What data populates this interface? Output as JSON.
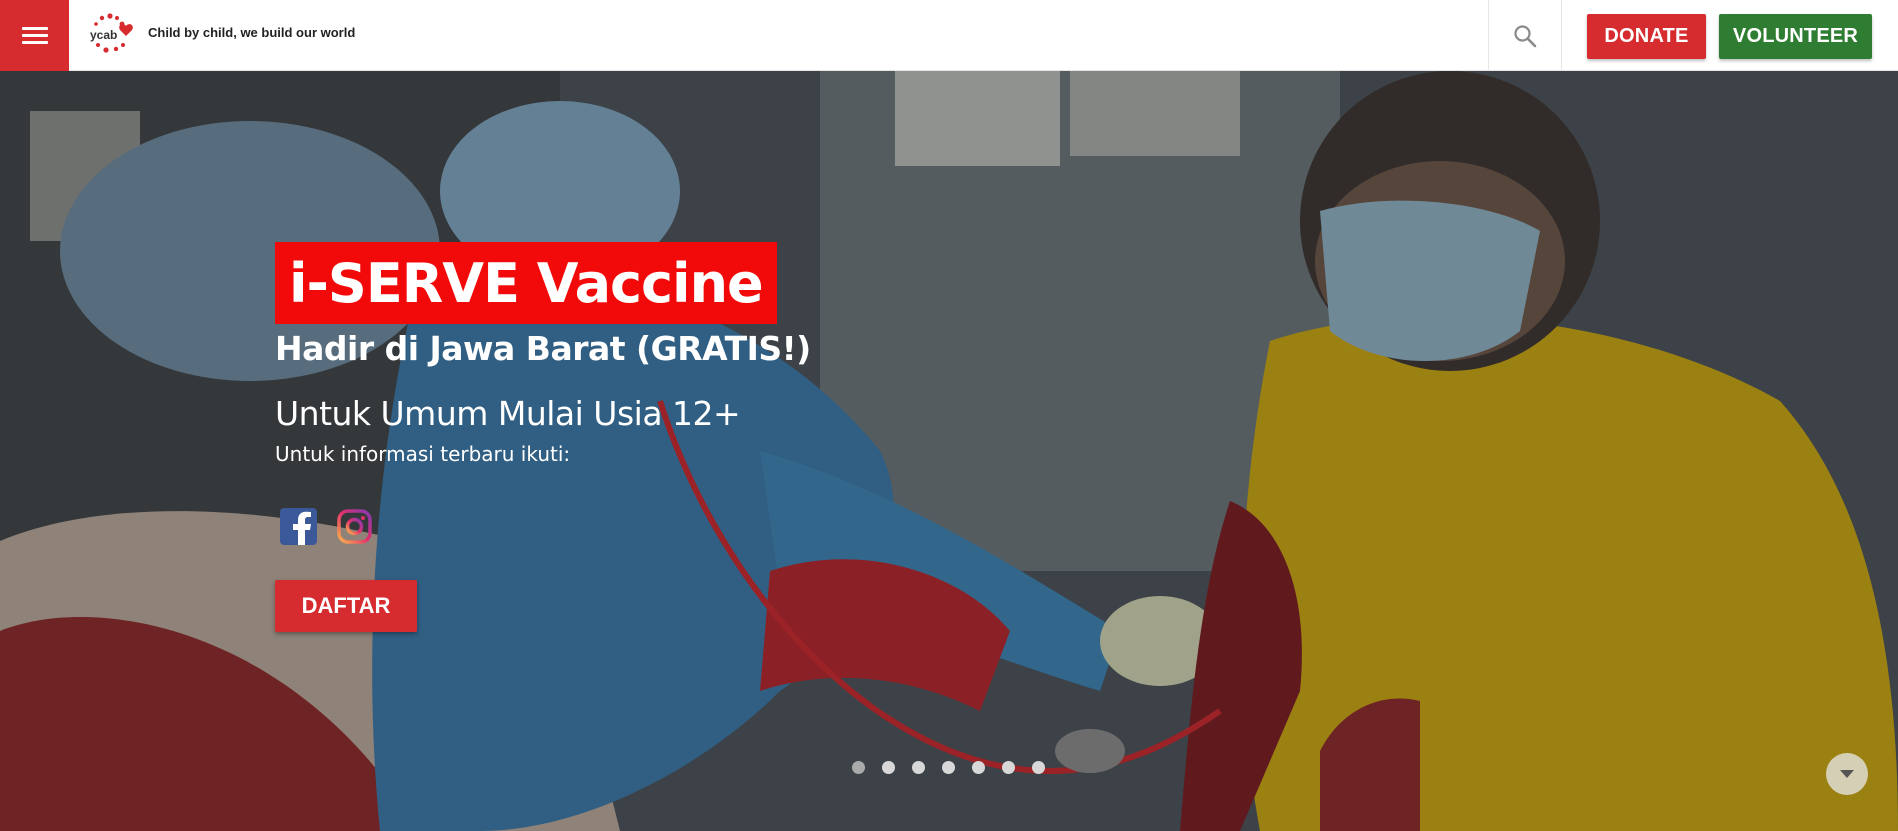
{
  "header": {
    "tagline": "Child by child, we build our world",
    "logo_text": "ycab",
    "donate_label": "DONATE",
    "volunteer_label": "VOLUNTEER",
    "icons": [
      "menu-icon",
      "ycab-logo",
      "search-icon"
    ]
  },
  "hero": {
    "title": "i-SERVE Vaccine",
    "subtitle": "Hadir di Jawa Barat (GRATIS!)",
    "subtitle2": "Untuk Umum Mulai Usia 12+",
    "info": "Untuk informasi terbaru ikuti:",
    "cta_label": "DAFTAR",
    "social_icons": [
      "facebook-icon",
      "instagram-icon"
    ],
    "slide_count": 7,
    "active_slide": 1
  },
  "colors": {
    "brand_red": "#d62c2f",
    "title_red": "#f20a0a",
    "volunteer_green": "#2e7d32"
  }
}
